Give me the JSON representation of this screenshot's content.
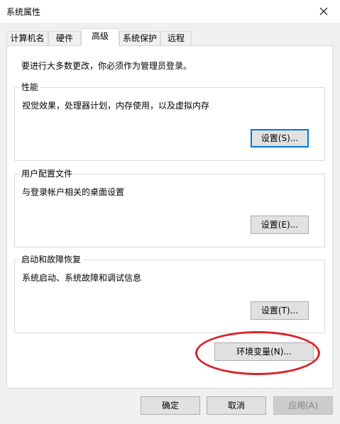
{
  "window": {
    "title": "系统属性",
    "close_icon": "close-icon"
  },
  "tabs": [
    {
      "label": "计算机名"
    },
    {
      "label": "硬件"
    },
    {
      "label": "高级",
      "active": true
    },
    {
      "label": "系统保护"
    },
    {
      "label": "远程"
    }
  ],
  "panel": {
    "intro": "要进行大多数更改，你必须作为管理员登录。",
    "performance": {
      "title": "性能",
      "desc": "视觉效果，处理器计划，内存使用，以及虚拟内存",
      "button": "设置(S)..."
    },
    "user_profiles": {
      "title": "用户配置文件",
      "desc": "与登录帐户相关的桌面设置",
      "button": "设置(E)..."
    },
    "startup_recovery": {
      "title": "启动和故障恢复",
      "desc": "系统启动、系统故障和调试信息",
      "button": "设置(T)..."
    },
    "env_button": "环境变量(N)..."
  },
  "footer": {
    "ok": "确定",
    "cancel": "取消",
    "apply": "应用(A)"
  },
  "colors": {
    "focus": "#0078d7",
    "annotation": "#d8232a"
  }
}
